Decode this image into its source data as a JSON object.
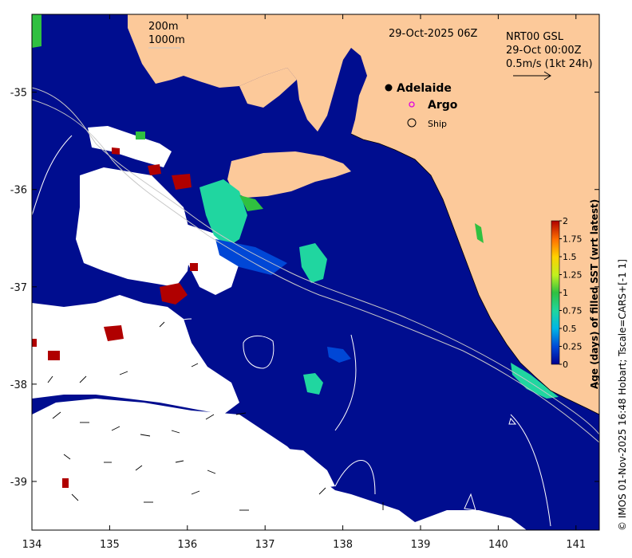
{
  "map": {
    "date_label": "29-Oct-2025 06Z",
    "depth_labels": [
      "200m",
      "1000m"
    ],
    "current_info": {
      "line1": "NRT00 GSL",
      "line2": "29-Oct 00:00Z",
      "line3": "0.5m/s (1kt 24h)"
    },
    "places": [
      {
        "name": "Adelaide",
        "lon": 138.6,
        "lat": -34.93
      }
    ],
    "legend": {
      "argo_label": "Argo",
      "ship_label": "Ship"
    },
    "x_ticks": [
      "134",
      "135",
      "136",
      "137",
      "138",
      "139",
      "140",
      "141"
    ],
    "y_ticks": [
      "-35",
      "-36",
      "-37",
      "-38",
      "-39"
    ],
    "x_range": [
      134,
      141.3
    ],
    "y_range": [
      -39.5,
      -34.2
    ],
    "credit": "© IMOS 01-Nov-2025 16:48 Hobart; Tscale=CARS+[-1 1]",
    "colors": {
      "land": "#fcc99a",
      "ocean": "#000d8f",
      "nodata": "#ffffff"
    }
  },
  "colorbar": {
    "title": "Age (days) of filled SST (wrt latest)",
    "ticks": [
      "0",
      "0.25",
      "0.5",
      "0.75",
      "1",
      "1.25",
      "1.5",
      "1.75",
      "2"
    ],
    "range": [
      0,
      2
    ],
    "colors": [
      "#00008f",
      "#0047d6",
      "#00b6e6",
      "#20d6a0",
      "#30c040",
      "#c0f020",
      "#ffd000",
      "#ff7000",
      "#b00000"
    ]
  }
}
